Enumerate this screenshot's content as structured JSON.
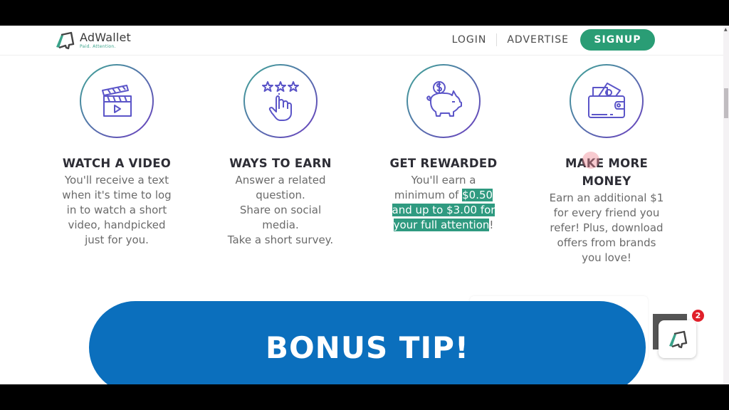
{
  "header": {
    "logo_name": "AdWallet",
    "logo_tagline": "Paid. Attention.",
    "nav": {
      "login": "LOGIN",
      "advertise": "ADVERTISE",
      "signup": "SIGNUP"
    }
  },
  "features": [
    {
      "icon": "clapperboard-icon",
      "title": "WATCH A VIDEO",
      "lines": [
        "You'll receive a text",
        "when it's time to log",
        "in to watch a short",
        "video, handpicked",
        "just for you."
      ]
    },
    {
      "icon": "stars-tap-icon",
      "title": "WAYS TO EARN",
      "lines": [
        "Answer a related",
        "question.",
        "Share on social",
        "media.",
        "Take a short survey."
      ]
    },
    {
      "icon": "piggy-bank-icon",
      "title": "GET REWARDED",
      "line1": "You'll earn a",
      "line2_plain": "minimum of ",
      "line2_hl": "$0.50",
      "line3_hl": "and up to $3.00 for",
      "line4_hl": "your full attention",
      "line4_tail": "!"
    },
    {
      "icon": "wallet-icon",
      "title_line1": "MAKE MORE",
      "title_line2": "MONEY",
      "lines": [
        "Earn an additional $1",
        "for every friend you",
        "refer! Plus, download",
        "offers from brands",
        "you love!"
      ]
    }
  ],
  "bonus_banner": {
    "label": "BONUS TIP!"
  },
  "chat_widget": {
    "badge_count": "2"
  },
  "colors": {
    "brand_green": "#2a9d75",
    "highlight": "#2f9a80",
    "banner_blue": "#0b6fbd",
    "badge_red": "#e0202a"
  }
}
